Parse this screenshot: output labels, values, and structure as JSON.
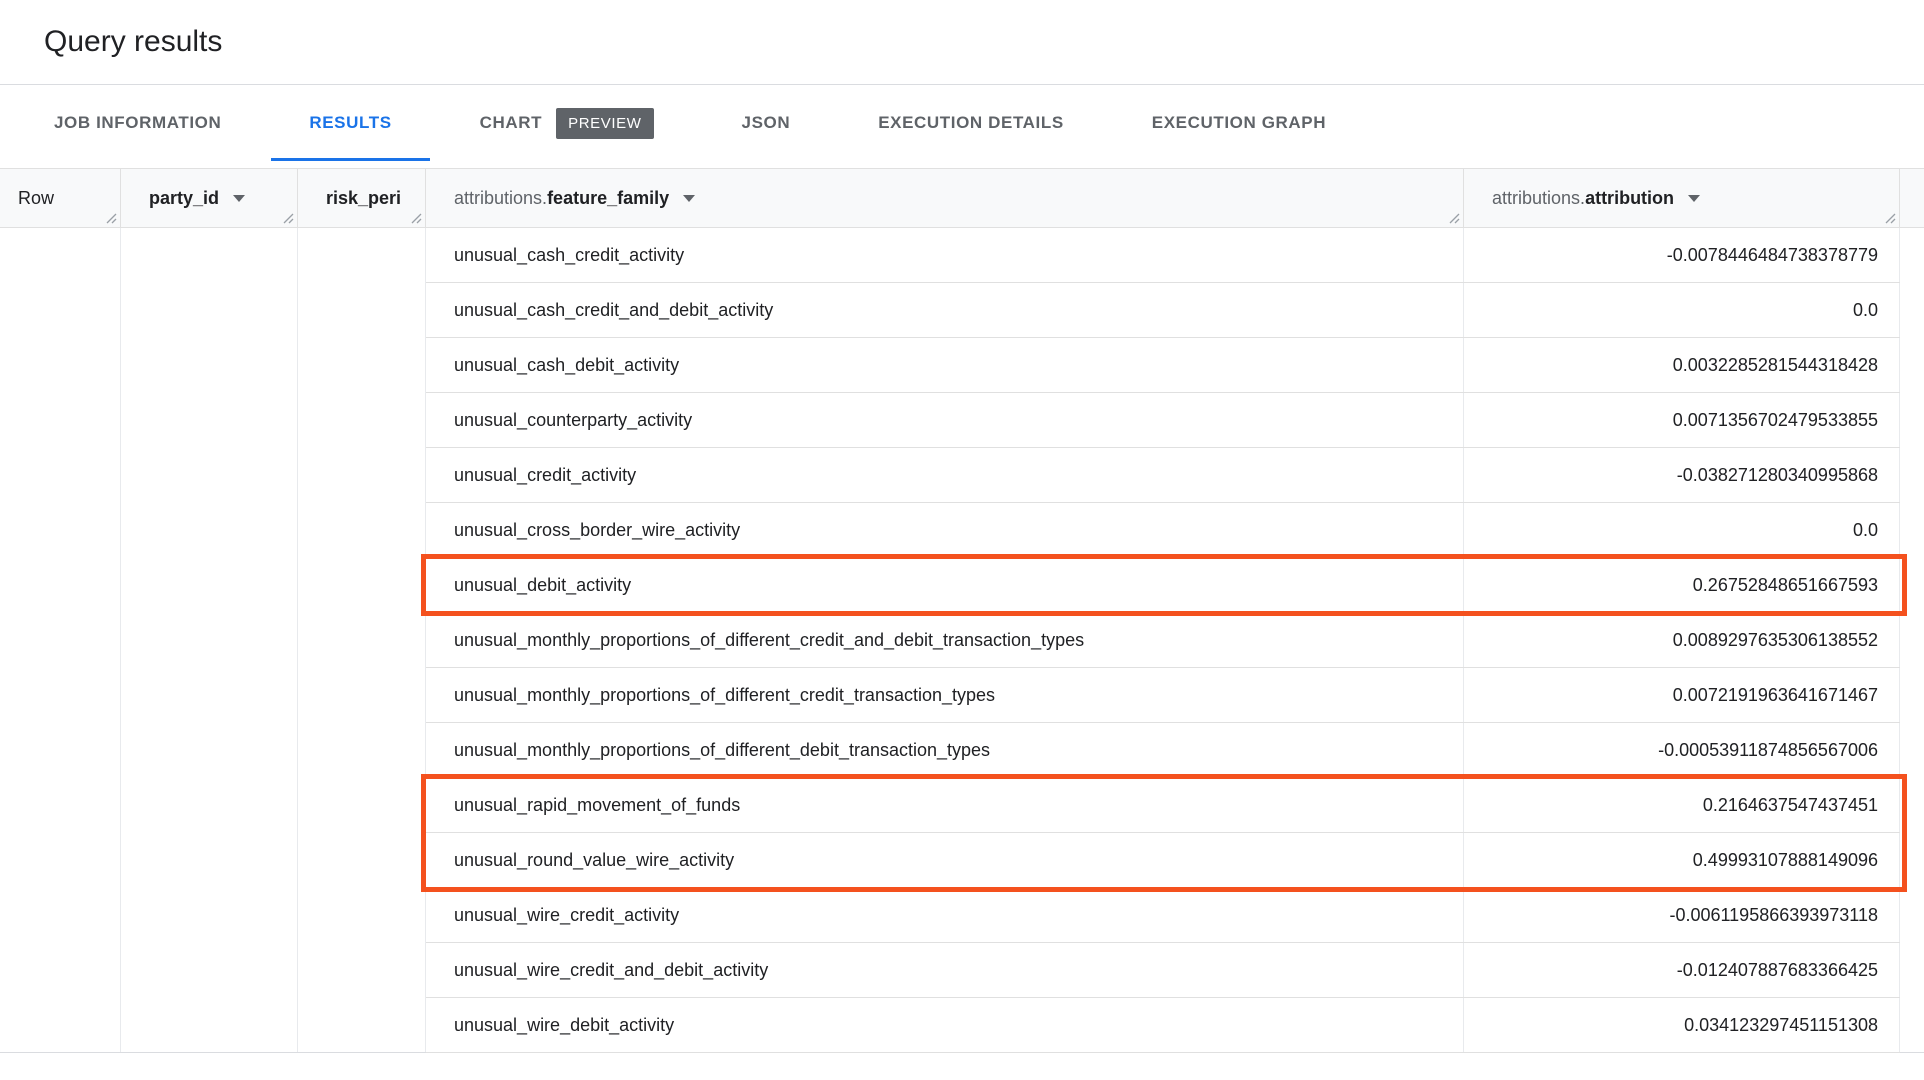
{
  "page": {
    "title": "Query results"
  },
  "tabs": {
    "job_information": "JOB INFORMATION",
    "results": "RESULTS",
    "chart": "CHART",
    "chart_badge": "PREVIEW",
    "json": "JSON",
    "execution_details": "EXECUTION DETAILS",
    "execution_graph": "EXECUTION GRAPH"
  },
  "table": {
    "columns": {
      "row": "Row",
      "party_id": "party_id",
      "risk_period": "risk_peri",
      "feature_family_prefix": "attributions.",
      "feature_family": "feature_family",
      "attribution_prefix": "attributions.",
      "attribution": "attribution"
    },
    "rows": [
      {
        "feature": "unusual_cash_credit_activity",
        "attribution": "-0.0078446484738378779"
      },
      {
        "feature": "unusual_cash_credit_and_debit_activity",
        "attribution": "0.0"
      },
      {
        "feature": "unusual_cash_debit_activity",
        "attribution": "0.0032285281544318428"
      },
      {
        "feature": "unusual_counterparty_activity",
        "attribution": "0.0071356702479533855"
      },
      {
        "feature": "unusual_credit_activity",
        "attribution": "-0.038271280340995868"
      },
      {
        "feature": "unusual_cross_border_wire_activity",
        "attribution": "0.0"
      },
      {
        "feature": "unusual_debit_activity",
        "attribution": "0.26752848651667593",
        "highlighted": true
      },
      {
        "feature": "unusual_monthly_proportions_of_different_credit_and_debit_transaction_types",
        "attribution": "0.0089297635306138552"
      },
      {
        "feature": "unusual_monthly_proportions_of_different_credit_transaction_types",
        "attribution": "0.0072191963641671467"
      },
      {
        "feature": "unusual_monthly_proportions_of_different_debit_transaction_types",
        "attribution": "-0.00053911874856567006"
      },
      {
        "feature": "unusual_rapid_movement_of_funds",
        "attribution": "0.2164637547437451",
        "highlighted": true
      },
      {
        "feature": "unusual_round_value_wire_activity",
        "attribution": "0.49993107888149096",
        "highlighted": true
      },
      {
        "feature": "unusual_wire_credit_activity",
        "attribution": "-0.0061195866393973118"
      },
      {
        "feature": "unusual_wire_credit_and_debit_activity",
        "attribution": "-0.012407887683366425"
      },
      {
        "feature": "unusual_wire_debit_activity",
        "attribution": "0.034123297451151308"
      }
    ]
  },
  "colors": {
    "accent": "#1a73e8",
    "highlight": "#f4511e",
    "badge_bg": "#5f6368"
  }
}
